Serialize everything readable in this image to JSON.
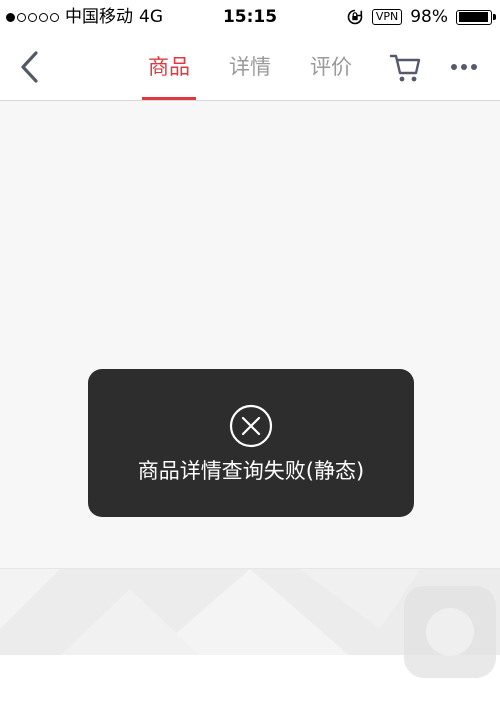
{
  "status_bar": {
    "carrier": "中国移动",
    "network": "4G",
    "time": "15:15",
    "vpn": "VPN",
    "battery": "98%",
    "battery_level": 0.98,
    "signal_strength": 1
  },
  "nav": {
    "tabs": [
      {
        "label": "商品",
        "active": true
      },
      {
        "label": "详情",
        "active": false
      },
      {
        "label": "评价",
        "active": false
      }
    ],
    "icons": {
      "back": "chevron-left-icon",
      "cart": "cart-icon",
      "more": "more-dots-icon"
    }
  },
  "toast": {
    "icon": "close-circle-icon",
    "message": "商品详情查询失败(静态)"
  },
  "colors": {
    "accent": "#e0383e",
    "toast_bg": "#262626",
    "tab_inactive": "#9a9a9a"
  }
}
